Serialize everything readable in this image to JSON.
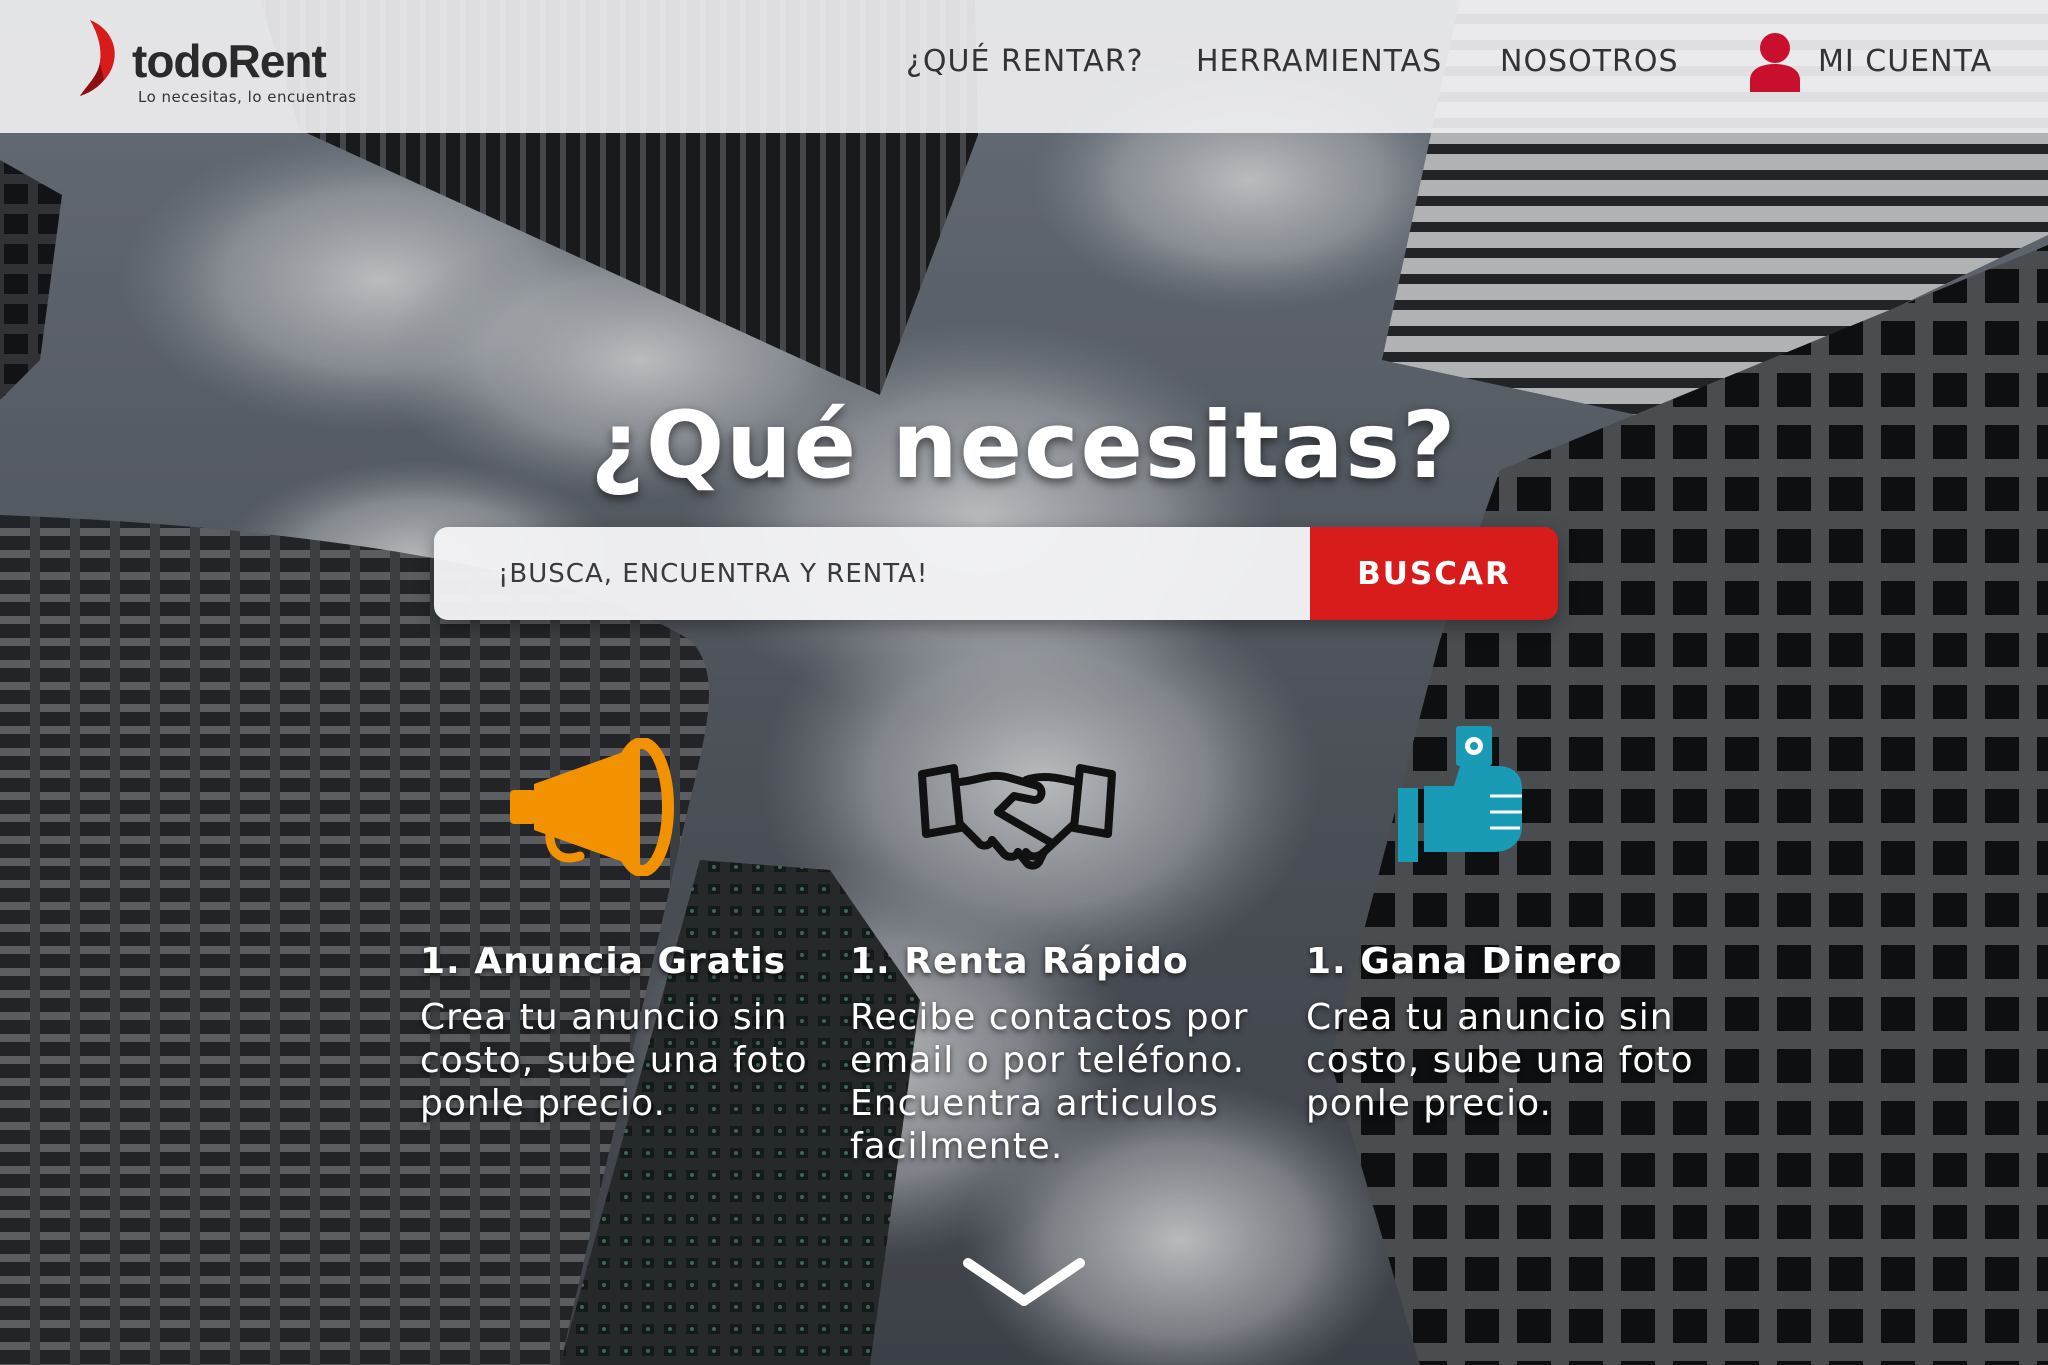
{
  "brand": {
    "name": "todoRent",
    "tagline": "Lo necesitas, lo encuentras",
    "accent_color": "#d81b1b"
  },
  "nav": {
    "items": [
      {
        "label": "¿QUÉ RENTAR?"
      },
      {
        "label": "HERRAMIENTAS"
      },
      {
        "label": "NOSOTROS"
      }
    ],
    "account": {
      "label": "MI CUENTA",
      "icon": "user-icon"
    }
  },
  "hero": {
    "title": "¿Qué necesitas?",
    "search": {
      "placeholder": "¡BUSCA, ENCUENTRA Y RENTA!",
      "value": "",
      "button_label": "BUSCAR"
    }
  },
  "features": [
    {
      "icon": "megaphone-icon",
      "icon_color": "#f39200",
      "title": "1. Anuncia Gratis",
      "lines": [
        "Crea tu anuncio sin",
        "costo, sube una foto",
        "ponle precio."
      ]
    },
    {
      "icon": "handshake-icon",
      "icon_color": "#111111",
      "title": "1. Renta Rápido",
      "lines": [
        "Recibe contactos por",
        "email o por teléfono.",
        "Encuentra articulos",
        "facilmente."
      ]
    },
    {
      "icon": "money-hand-icon",
      "icon_color": "#1a9bb5",
      "title": "1. Gana Dinero",
      "lines": [
        "Crea tu anuncio sin",
        "costo, sube una foto",
        "ponle precio."
      ]
    }
  ],
  "scroll_indicator": {
    "icon": "chevron-down-icon"
  }
}
